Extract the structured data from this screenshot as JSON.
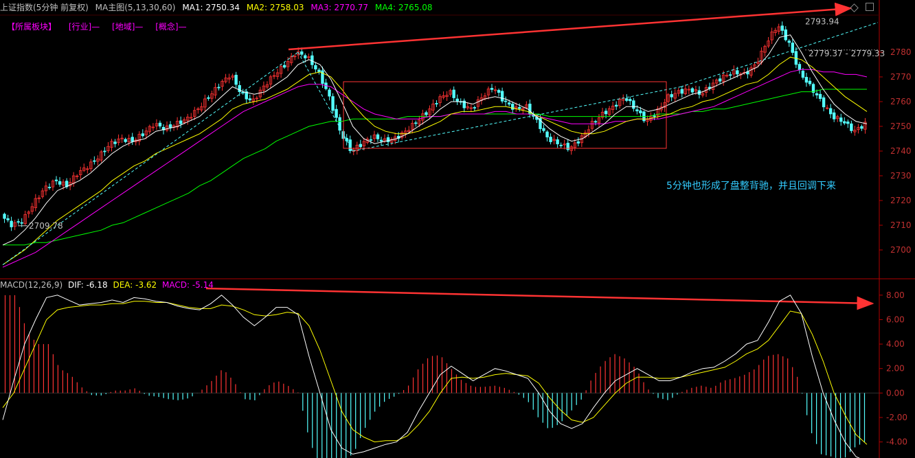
{
  "header": {
    "title": "上证指数(5分钟 前复权)",
    "indicator": "MA主图(5,13,30,60)",
    "ma1": "MA1: 2750.34",
    "ma2": "MA2: 2758.03",
    "ma3": "MA3: 2770.77",
    "ma4": "MA4: 2765.08"
  },
  "sectors": [
    "【所属板块】",
    "[行业]—",
    "[地域]—",
    "[概念]—"
  ],
  "macd_header": {
    "name": "MACD(12,26,9)",
    "dif": "DIF: -6.18",
    "dea": "DEA: -3.62",
    "macd": "MACD: -5.14"
  },
  "annotation": "5分钟也形成了盘整背驰，并且回调下来",
  "colors": {
    "up": "#ff3333",
    "down": "#54ffff",
    "ma1": "#ffffff",
    "ma2": "#ffff00",
    "ma3": "#ff00ff",
    "ma4": "#00ff00",
    "dif": "#ffffff",
    "dea": "#ffff00",
    "axis": "#b00000",
    "arrow": "#ff3333",
    "box": "#ff3333",
    "trend": "#54ffff"
  },
  "chart_data": [
    {
      "type": "candlestick",
      "ylim": [
        2690,
        2795
      ],
      "yticks": [
        2700,
        2710,
        2720,
        2730,
        2740,
        2750,
        2760,
        2770,
        2780
      ],
      "labels": [
        "2709.78",
        "2793.94",
        "2779.37 - 2779.33"
      ],
      "close_path": [
        2714,
        2710,
        2712,
        2719,
        2725,
        2728,
        2726,
        2731,
        2734,
        2738,
        2743,
        2745,
        2744,
        2747,
        2751,
        2749,
        2751,
        2753,
        2757,
        2762,
        2767,
        2771,
        2763,
        2760,
        2766,
        2771,
        2775,
        2780,
        2778,
        2772,
        2762,
        2748,
        2740,
        2743,
        2746,
        2744,
        2745,
        2748,
        2752,
        2756,
        2761,
        2764,
        2759,
        2757,
        2762,
        2766,
        2760,
        2757,
        2758,
        2752,
        2745,
        2743,
        2741,
        2745,
        2751,
        2755,
        2758,
        2762,
        2757,
        2752,
        2756,
        2762,
        2764,
        2765,
        2763,
        2767,
        2770,
        2772,
        2771,
        2775,
        2784,
        2791,
        2784,
        2772,
        2766,
        2760,
        2754,
        2752,
        2748,
        2751
      ],
      "ma1": [
        2702,
        2704,
        2708,
        2713,
        2719,
        2724,
        2726,
        2728,
        2731,
        2735,
        2739,
        2742,
        2744,
        2745,
        2748,
        2749,
        2750,
        2752,
        2754,
        2758,
        2762,
        2766,
        2764,
        2763,
        2764,
        2767,
        2770,
        2775,
        2777,
        2775,
        2769,
        2760,
        2750,
        2745,
        2743,
        2744,
        2745,
        2747,
        2750,
        2753,
        2757,
        2760,
        2760,
        2759,
        2761,
        2762,
        2761,
        2759,
        2757,
        2753,
        2749,
        2746,
        2744,
        2745,
        2748,
        2751,
        2755,
        2758,
        2758,
        2756,
        2757,
        2759,
        2761,
        2763,
        2764,
        2766,
        2768,
        2770,
        2772,
        2774,
        2779,
        2786,
        2787,
        2780,
        2772,
        2765,
        2759,
        2755,
        2752,
        2751
      ],
      "ma2": [
        2694,
        2697,
        2700,
        2704,
        2708,
        2712,
        2715,
        2718,
        2721,
        2724,
        2728,
        2731,
        2734,
        2736,
        2739,
        2741,
        2743,
        2745,
        2747,
        2750,
        2753,
        2757,
        2759,
        2760,
        2761,
        2763,
        2765,
        2768,
        2771,
        2772,
        2770,
        2765,
        2759,
        2754,
        2750,
        2748,
        2747,
        2747,
        2748,
        2750,
        2752,
        2755,
        2756,
        2756,
        2757,
        2758,
        2758,
        2757,
        2756,
        2754,
        2752,
        2750,
        2748,
        2747,
        2747,
        2748,
        2750,
        2752,
        2753,
        2753,
        2754,
        2755,
        2757,
        2758,
        2760,
        2761,
        2763,
        2765,
        2767,
        2768,
        2771,
        2775,
        2778,
        2777,
        2774,
        2770,
        2766,
        2762,
        2759,
        2756
      ],
      "ma3": [
        2693,
        2695,
        2697,
        2699,
        2702,
        2705,
        2708,
        2711,
        2714,
        2717,
        2720,
        2723,
        2726,
        2729,
        2732,
        2735,
        2738,
        2741,
        2744,
        2747,
        2750,
        2753,
        2756,
        2758,
        2760,
        2762,
        2764,
        2766,
        2767,
        2767,
        2766,
        2763,
        2760,
        2757,
        2755,
        2754,
        2753,
        2753,
        2753,
        2754,
        2754,
        2755,
        2755,
        2755,
        2755,
        2756,
        2756,
        2755,
        2755,
        2754,
        2753,
        2752,
        2751,
        2751,
        2751,
        2751,
        2752,
        2752,
        2753,
        2753,
        2753,
        2754,
        2755,
        2756,
        2757,
        2758,
        2760,
        2762,
        2764,
        2766,
        2768,
        2770,
        2772,
        2773,
        2773,
        2772,
        2772,
        2771,
        2771,
        2770
      ],
      "ma4": [
        2702,
        2702,
        2702,
        2703,
        2703,
        2704,
        2705,
        2706,
        2707,
        2708,
        2710,
        2711,
        2713,
        2715,
        2717,
        2719,
        2721,
        2723,
        2726,
        2728,
        2731,
        2734,
        2737,
        2739,
        2741,
        2744,
        2746,
        2748,
        2750,
        2751,
        2752,
        2752,
        2753,
        2753,
        2753,
        2753,
        2753,
        2754,
        2754,
        2754,
        2754,
        2755,
        2755,
        2755,
        2755,
        2755,
        2755,
        2755,
        2755,
        2755,
        2754,
        2754,
        2754,
        2754,
        2754,
        2754,
        2754,
        2754,
        2754,
        2754,
        2755,
        2755,
        2755,
        2756,
        2756,
        2757,
        2757,
        2758,
        2759,
        2760,
        2761,
        2762,
        2763,
        2764,
        2764,
        2765,
        2765,
        2765,
        2765,
        2765
      ]
    },
    {
      "type": "macd",
      "ylim": [
        -5.2,
        9
      ],
      "yticks": [
        -4.0,
        -2.0,
        0.0,
        2.0,
        4.0,
        6.0,
        8.0
      ],
      "ytick_labels": [
        "-4.00",
        "-2.00",
        "0.00",
        "2.00",
        "4.00",
        "6.00",
        "8.00"
      ],
      "dif": [
        -2.2,
        1,
        4,
        6,
        7.8,
        8,
        7.6,
        7.2,
        7.3,
        7.4,
        7.6,
        7.4,
        7.8,
        7.7,
        7.5,
        7.4,
        7.1,
        6.9,
        6.8,
        7.3,
        8,
        7.2,
        6.2,
        5.5,
        6.2,
        7,
        7,
        6.4,
        3,
        0,
        -3,
        -4.5,
        -5,
        -4.8,
        -4.5,
        -4.2,
        -4.0,
        -3.2,
        -1.5,
        0,
        1.5,
        2.2,
        1.6,
        1.0,
        1.5,
        2.0,
        1.8,
        1.5,
        1.2,
        0,
        -1.5,
        -2.5,
        -2.9,
        -2.5,
        -1.2,
        0,
        1.0,
        1.5,
        2.0,
        1.5,
        1.0,
        1.0,
        1.3,
        1.7,
        2.0,
        2.1,
        2.6,
        3.2,
        4.0,
        4.3,
        5.8,
        7.5,
        8,
        6.5,
        3,
        0,
        -2.2,
        -4,
        -5.2,
        -5.6
      ],
      "dea": [
        -1.2,
        0,
        2,
        4,
        6,
        6.8,
        7,
        7.1,
        7.2,
        7.2,
        7.3,
        7.3,
        7.5,
        7.5,
        7.4,
        7.4,
        7.2,
        7.0,
        6.9,
        6.9,
        7.2,
        7.1,
        6.8,
        6.4,
        6.3,
        6.4,
        6.6,
        6.5,
        5.5,
        3.5,
        1,
        -1.5,
        -3,
        -3.6,
        -4,
        -3.9,
        -3.9,
        -3.5,
        -2.6,
        -1.5,
        0,
        1.2,
        1.3,
        1.2,
        1.3,
        1.5,
        1.6,
        1.5,
        1.4,
        0.8,
        -0.4,
        -1.4,
        -2.2,
        -2.4,
        -2.0,
        -1.0,
        0,
        0.8,
        1.3,
        1.3,
        1.2,
        1.2,
        1.3,
        1.5,
        1.7,
        1.9,
        2.1,
        2.6,
        3.2,
        3.6,
        4.3,
        5.5,
        6.7,
        6.5,
        4.8,
        2.6,
        0,
        -1.8,
        -3.4,
        -4.2
      ],
      "hist": [
        8,
        8,
        5,
        4,
        4,
        2,
        1.5,
        0.5,
        -0.2,
        -0.2,
        0.2,
        0.2,
        0.4,
        -0.2,
        -0.3,
        -0.5,
        -0.6,
        -0.4,
        0.2,
        1,
        2,
        1,
        -0.5,
        -0.6,
        0.5,
        1,
        0.6,
        0,
        -4,
        -6,
        -6.5,
        -5.5,
        -5,
        -3,
        -1.5,
        -0.6,
        -0.2,
        0.5,
        2,
        3,
        3.1,
        2,
        1,
        0.5,
        0.5,
        0.6,
        0.4,
        0,
        -0.6,
        -2,
        -3,
        -2.5,
        -1.5,
        -0.5,
        1.3,
        2.5,
        3.2,
        2.8,
        2,
        0.4,
        -0.4,
        -0.6,
        0,
        0.4,
        0.6,
        0.4,
        1,
        1.2,
        1.5,
        2,
        3,
        3.2,
        2.8,
        1,
        -3,
        -5,
        -5.2,
        -5.5,
        -4.5,
        -4
      ]
    }
  ]
}
